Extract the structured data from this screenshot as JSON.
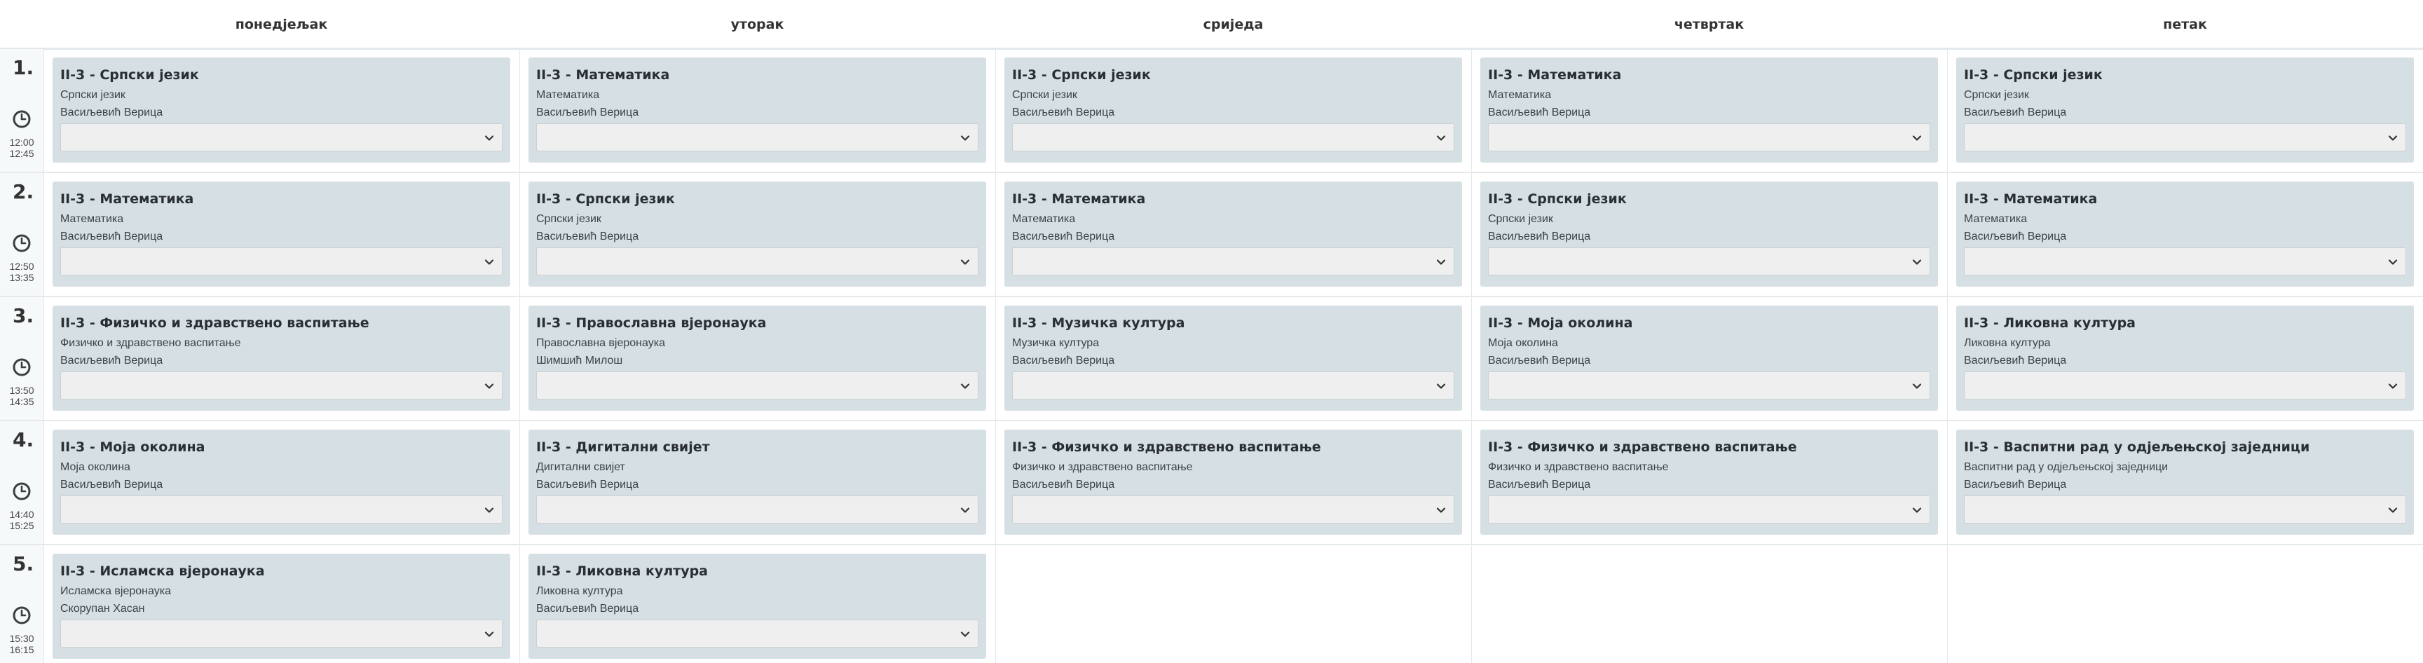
{
  "days": [
    "понедјељак",
    "уторак",
    "сриједа",
    "четвртак",
    "петак"
  ],
  "periods": [
    {
      "num": "1.",
      "start": "12:00",
      "end": "12:45"
    },
    {
      "num": "2.",
      "start": "12:50",
      "end": "13:35"
    },
    {
      "num": "3.",
      "start": "13:50",
      "end": "14:35"
    },
    {
      "num": "4.",
      "start": "14:40",
      "end": "15:25"
    },
    {
      "num": "5.",
      "start": "15:30",
      "end": "16:15"
    }
  ],
  "lessons": [
    [
      {
        "title": "II-3 - Српски језик",
        "subject": "Српски језик",
        "teacher": "Васиљевић Верица"
      },
      {
        "title": "II-3 - Математика",
        "subject": "Математика",
        "teacher": "Васиљевић Верица"
      },
      {
        "title": "II-3 - Српски језик",
        "subject": "Српски језик",
        "teacher": "Васиљевић Верица"
      },
      {
        "title": "II-3 - Математика",
        "subject": "Математика",
        "teacher": "Васиљевић Верица"
      },
      {
        "title": "II-3 - Српски језик",
        "subject": "Српски језик",
        "teacher": "Васиљевић Верица"
      }
    ],
    [
      {
        "title": "II-3 - Математика",
        "subject": "Математика",
        "teacher": "Васиљевић Верица"
      },
      {
        "title": "II-3 - Српски језик",
        "subject": "Српски језик",
        "teacher": "Васиљевић Верица"
      },
      {
        "title": "II-3 - Математика",
        "subject": "Математика",
        "teacher": "Васиљевић Верица"
      },
      {
        "title": "II-3 - Српски језик",
        "subject": "Српски језик",
        "teacher": "Васиљевић Верица"
      },
      {
        "title": "II-3 - Математика",
        "subject": "Математика",
        "teacher": "Васиљевић Верица"
      }
    ],
    [
      {
        "title": "II-3 - Физичко и здравствено васпитање",
        "subject": "Физичко и здравствено васпитање",
        "teacher": "Васиљевић Верица"
      },
      {
        "title": "II-3 - Православна вјеронаука",
        "subject": "Православна вјеронаука",
        "teacher": "Шимшић Милош"
      },
      {
        "title": "II-3 - Музичка култура",
        "subject": "Музичка култура",
        "teacher": "Васиљевић Верица"
      },
      {
        "title": "II-3 - Моја околина",
        "subject": "Моја околина",
        "teacher": "Васиљевић Верица"
      },
      {
        "title": "II-3 - Ликовна култура",
        "subject": "Ликовна култура",
        "teacher": "Васиљевић Верица"
      }
    ],
    [
      {
        "title": "II-3 - Моја околина",
        "subject": "Моја околина",
        "teacher": "Васиљевић Верица"
      },
      {
        "title": "II-3 - Дигитални свијет",
        "subject": "Дигитални свијет",
        "teacher": "Васиљевић Верица"
      },
      {
        "title": "II-3 - Физичко и здравствено васпитање",
        "subject": "Физичко и здравствено васпитање",
        "teacher": "Васиљевић Верица"
      },
      {
        "title": "II-3 - Физичко и здравствено васпитање",
        "subject": "Физичко и здравствено васпитање",
        "teacher": "Васиљевић Верица"
      },
      {
        "title": "II-3 - Васпитни рад у одјељењској заједници",
        "subject": "Васпитни рад у одјељењској заједници",
        "teacher": "Васиљевић Верица"
      }
    ],
    [
      {
        "title": "II-3 - Исламска вјеронаука",
        "subject": "Исламска вјеронаука",
        "teacher": "Скорупан Хасан"
      },
      {
        "title": "II-3 - Ликовна култура",
        "subject": "Ликовна култура",
        "teacher": "Васиљевић Верица"
      },
      null,
      null,
      null
    ]
  ],
  "colors": {
    "card_bg": "#d6e0e4",
    "select_bg": "#efefef",
    "grid_line": "#e4e9ec",
    "period_bg": "#f6f9fa"
  }
}
